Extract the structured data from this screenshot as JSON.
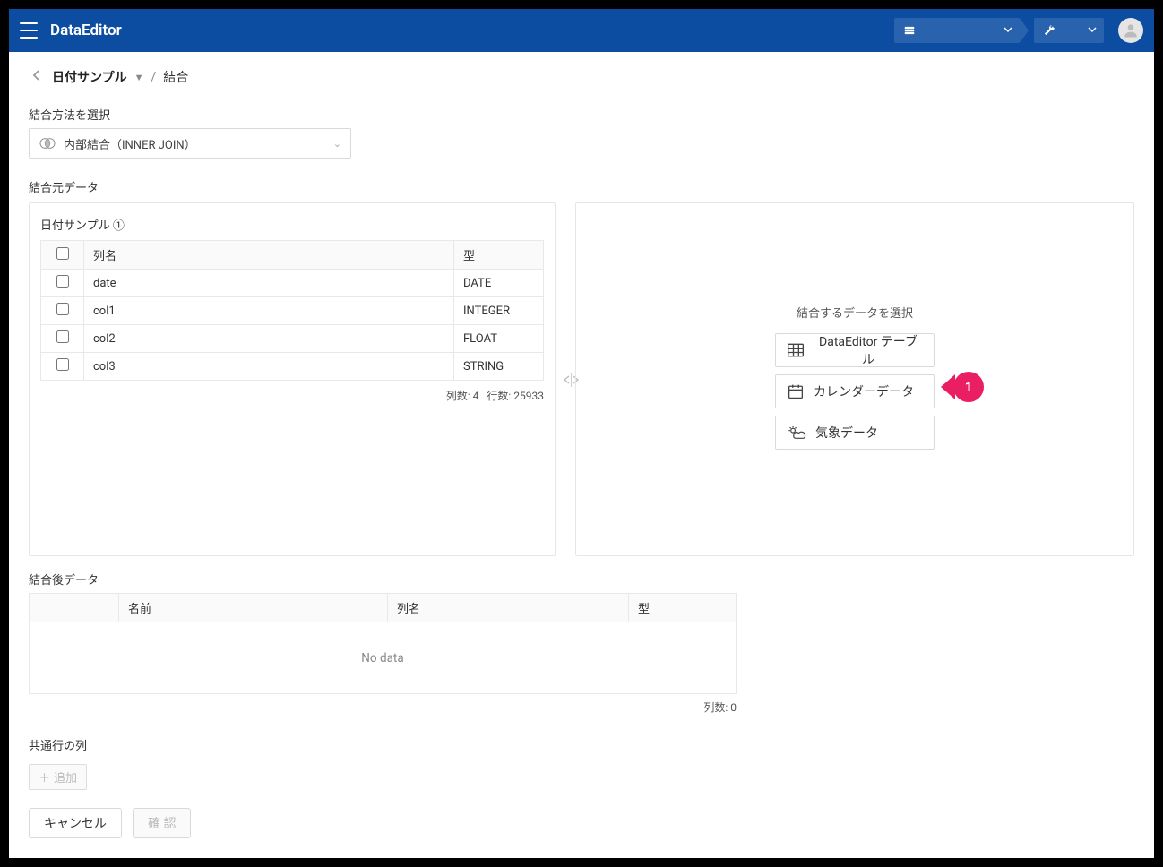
{
  "header": {
    "app_title": "DataEditor"
  },
  "breadcrumb": {
    "parent": "日付サンプル",
    "separator": "/",
    "current": "結合"
  },
  "join_method": {
    "label": "結合方法を選択",
    "selected": "内部結合（INNER JOIN）"
  },
  "source": {
    "section_label": "結合元データ",
    "panel_title": "日付サンプル ①",
    "headers": {
      "name": "列名",
      "type": "型"
    },
    "columns": [
      {
        "name": "date",
        "type": "DATE"
      },
      {
        "name": "col1",
        "type": "INTEGER"
      },
      {
        "name": "col2",
        "type": "FLOAT"
      },
      {
        "name": "col3",
        "type": "STRING"
      }
    ],
    "footer_cols_label": "列数:",
    "footer_cols": "4",
    "footer_rows_label": "行数:",
    "footer_rows": "25933"
  },
  "selector": {
    "title": "結合するデータを選択",
    "options": {
      "table": "DataEditor テーブル",
      "calendar": "カレンダーデータ",
      "weather": "気象データ"
    }
  },
  "callout": {
    "num": "1"
  },
  "after": {
    "section_label": "結合後データ",
    "headers": {
      "name": "名前",
      "col": "列名",
      "type": "型"
    },
    "empty": "No data",
    "footer_cols_label": "列数:",
    "footer_cols": "0"
  },
  "common": {
    "section_label": "共通行の列",
    "add_label": "追加"
  },
  "footer": {
    "cancel": "キャンセル",
    "ok": "確 認"
  }
}
